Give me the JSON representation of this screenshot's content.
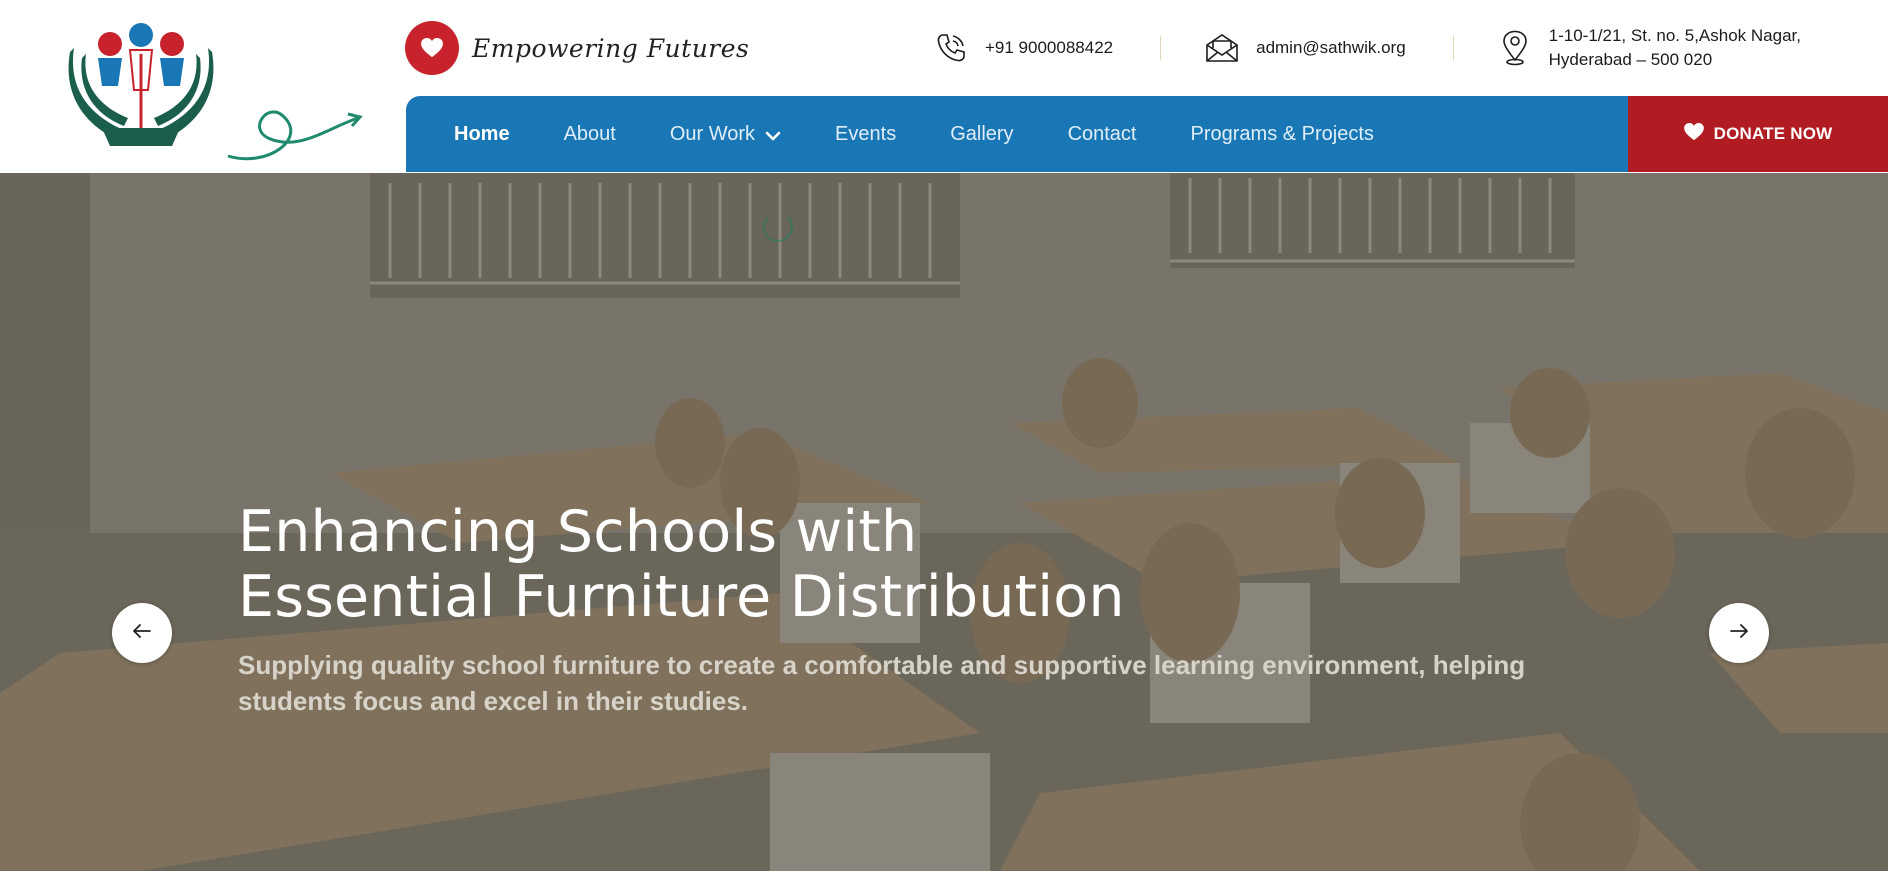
{
  "header": {
    "tagline": "Empowering Futures",
    "contacts": {
      "phone": "+91 9000088422",
      "email": "admin@sathwik.org",
      "address_line1": "1-10-1/21, St. no. 5,Ashok Nagar,",
      "address_line2": "Hyderabad – 500 020"
    }
  },
  "nav": {
    "items": [
      {
        "label": "Home"
      },
      {
        "label": "About"
      },
      {
        "label": "Our Work"
      },
      {
        "label": "Events"
      },
      {
        "label": "Gallery"
      },
      {
        "label": "Contact"
      },
      {
        "label": "Programs & Projects"
      }
    ],
    "donate_label": "DONATE NOW"
  },
  "hero": {
    "title_line1": "Enhancing Schools with",
    "title_line2": "Essential Furniture Distribution",
    "subtitle": "Supplying quality school furniture to create a comfortable and supportive learning environment, helping students focus and excel in their studies."
  },
  "icons": {
    "tagline": "heart-icon",
    "phone": "phone-icon",
    "email": "envelope-icon",
    "address": "location-pin-icon",
    "dropdown": "chevron-down-icon",
    "donate": "heart-icon",
    "prev": "arrow-left-icon",
    "next": "arrow-right-icon"
  },
  "colors": {
    "nav_bg": "#1a77b5",
    "donate_bg": "#b11c22",
    "accent_red": "#c8232c",
    "brand_green": "#1b5e4c"
  }
}
